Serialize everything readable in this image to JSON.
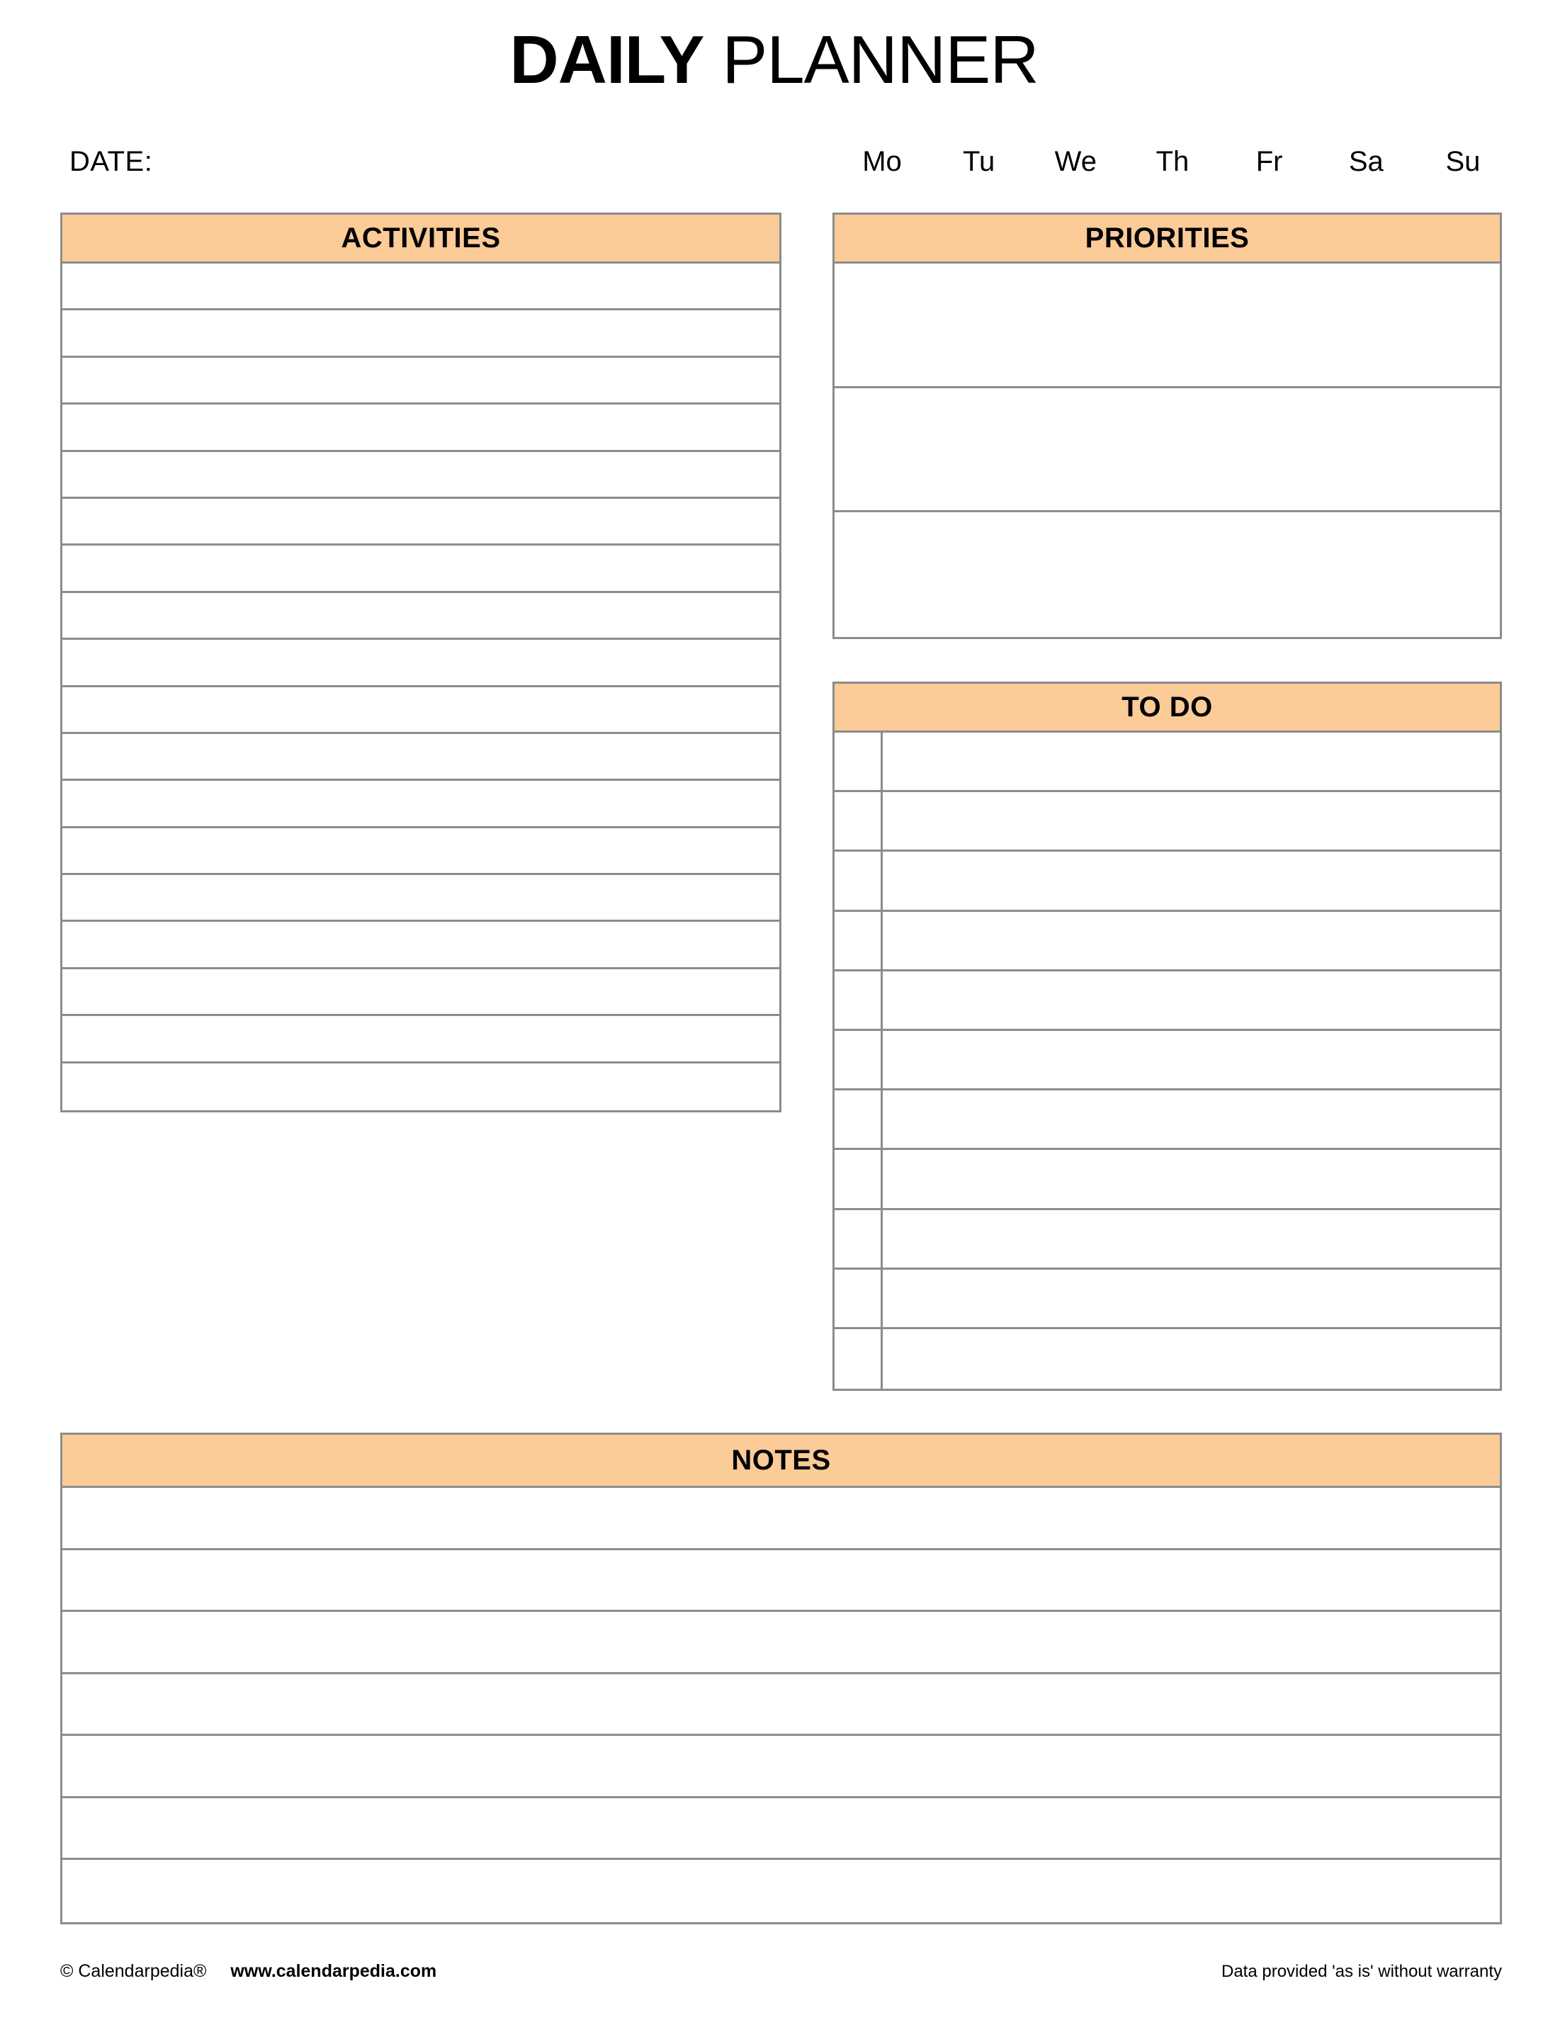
{
  "document": {
    "title_strong": "DAILY",
    "title_light": " PLANNER"
  },
  "date_row": {
    "date_label": "DATE:",
    "weekdays": [
      "Mo",
      "Tu",
      "We",
      "Th",
      "Fr",
      "Sa",
      "Su"
    ]
  },
  "sections": {
    "activities": {
      "header": "ACTIVITIES",
      "row_count": 18,
      "rows": [
        "",
        "",
        "",
        "",
        "",
        "",
        "",
        "",
        "",
        "",
        "",
        "",
        "",
        "",
        "",
        "",
        "",
        ""
      ]
    },
    "priorities": {
      "header": "PRIORITIES",
      "row_count": 3,
      "rows": [
        "",
        "",
        ""
      ]
    },
    "todo": {
      "header": "TO DO",
      "row_count": 11,
      "rows": [
        {
          "checked": "",
          "text": ""
        },
        {
          "checked": "",
          "text": ""
        },
        {
          "checked": "",
          "text": ""
        },
        {
          "checked": "",
          "text": ""
        },
        {
          "checked": "",
          "text": ""
        },
        {
          "checked": "",
          "text": ""
        },
        {
          "checked": "",
          "text": ""
        },
        {
          "checked": "",
          "text": ""
        },
        {
          "checked": "",
          "text": ""
        },
        {
          "checked": "",
          "text": ""
        },
        {
          "checked": "",
          "text": ""
        }
      ]
    },
    "notes": {
      "header": "NOTES",
      "row_count": 7,
      "rows": [
        "",
        "",
        "",
        "",
        "",
        "",
        ""
      ]
    }
  },
  "footer": {
    "copyright": "© Calendarpedia®",
    "url": "www.calendarpedia.com",
    "disclaimer": "Data provided 'as is' without warranty"
  },
  "colors": {
    "header_fill": "#fbcb98",
    "border": "#8c8c8c",
    "text": "#000000",
    "page_background": "#ffffff"
  }
}
